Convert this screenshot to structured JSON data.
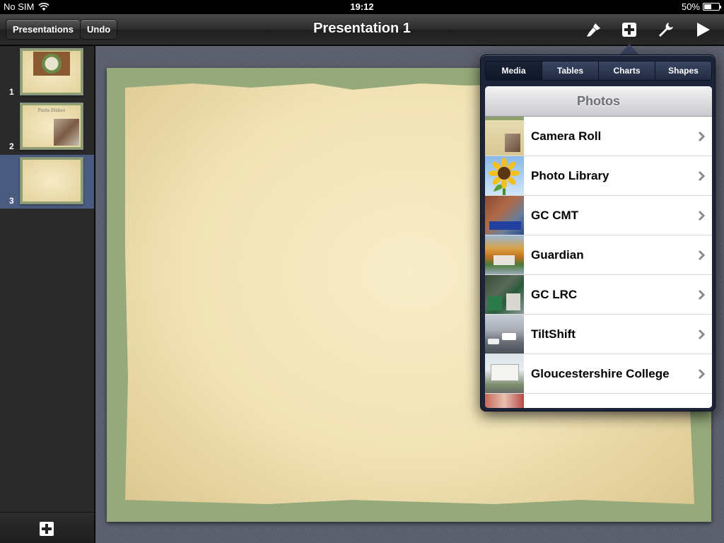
{
  "status": {
    "carrier": "No SIM",
    "time": "19:12",
    "battery": "50%",
    "battery_level": 0.5
  },
  "toolbar": {
    "presentations_label": "Presentations",
    "undo_label": "Undo",
    "title": "Presentation 1",
    "icons": [
      "paintbrush-icon",
      "add-icon",
      "wrench-icon",
      "play-icon"
    ]
  },
  "slides": [
    {
      "number": "1"
    },
    {
      "number": "2",
      "title": "Pasta Dishes"
    },
    {
      "number": "3"
    }
  ],
  "popover": {
    "tabs": [
      "Media",
      "Tables",
      "Charts",
      "Shapes"
    ],
    "active_tab": "Media",
    "header": "Photos",
    "items": [
      {
        "label": "Camera Roll"
      },
      {
        "label": "Photo Library"
      },
      {
        "label": "GC CMT"
      },
      {
        "label": "Guardian"
      },
      {
        "label": "GC LRC"
      },
      {
        "label": "TiltShift"
      },
      {
        "label": "Gloucestershire College"
      }
    ]
  },
  "colors": {
    "selection": "#4a5b80",
    "popover": "#1b2438",
    "slide_frame": "#95a97a",
    "paper": "#f1e3b5"
  }
}
